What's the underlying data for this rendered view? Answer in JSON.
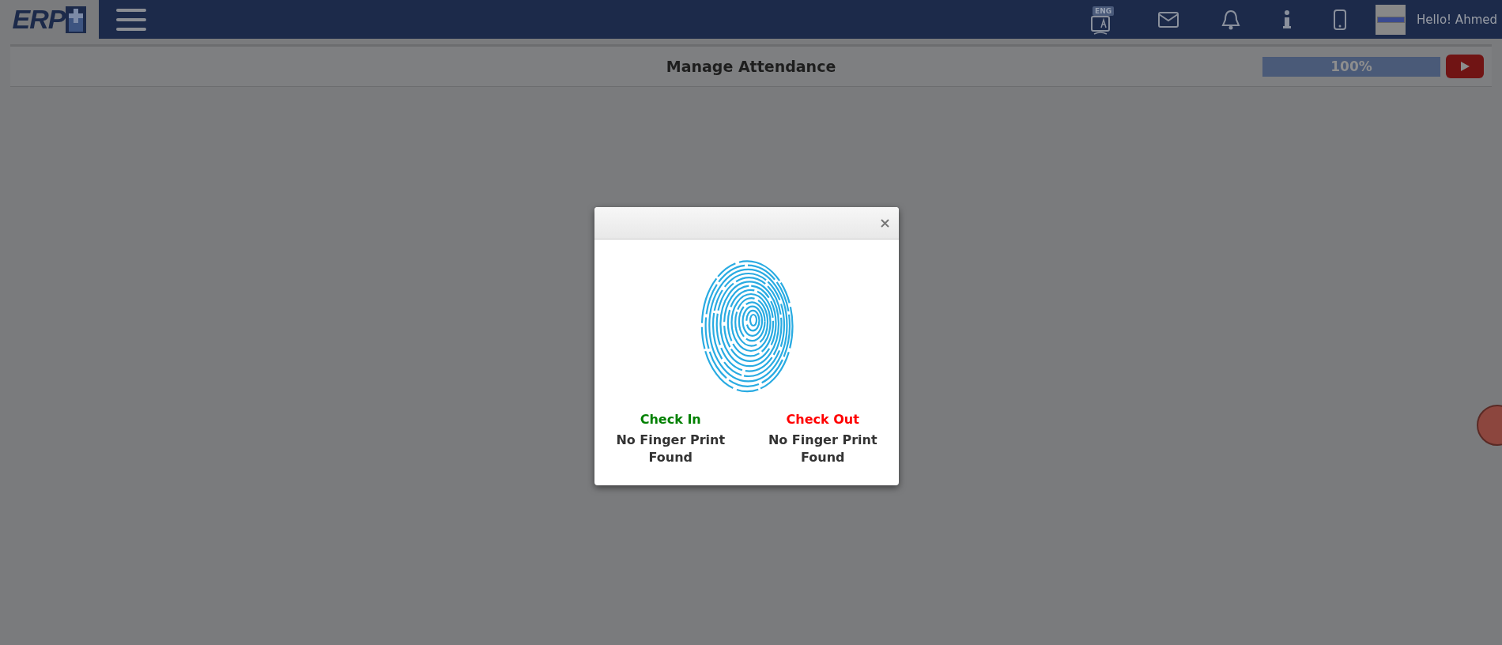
{
  "navbar": {
    "logo": "ERP",
    "language_badge": "ENG",
    "greeting": "Hello! Ahmed"
  },
  "header": {
    "title": "Manage Attendance",
    "progress": {
      "level": 1.0,
      "reading": "100%"
    }
  },
  "dialog": {
    "columns": [
      {
        "label": "Check In",
        "color": "#008000",
        "status": "No Finger Print Found"
      },
      {
        "label": "Check Out",
        "color": "#ff0000",
        "status": "No Finger Print Found"
      }
    ]
  }
}
